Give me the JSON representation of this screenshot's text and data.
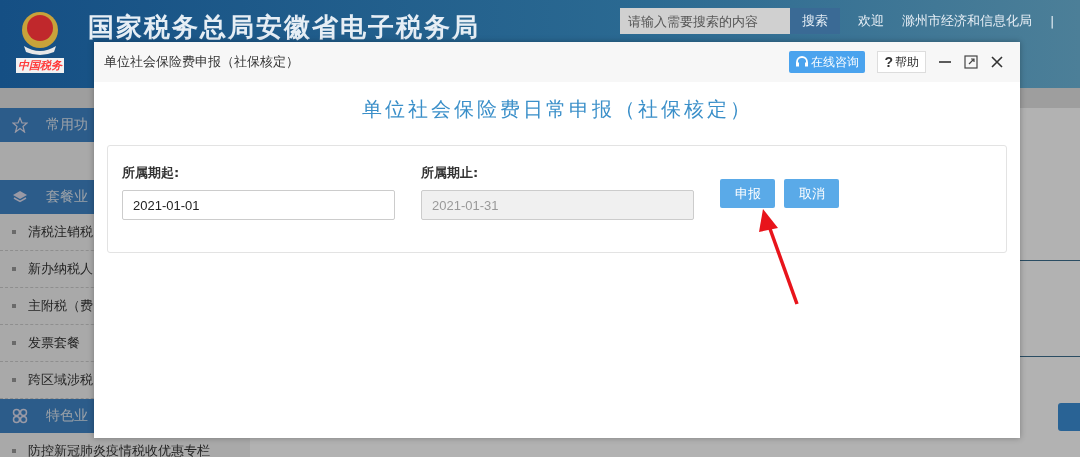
{
  "header": {
    "logo_text": "中国税务",
    "site_title": "国家税务总局安徽省电子税务局",
    "search": {
      "placeholder": "请输入需要搜索的内容"
    },
    "search_button": "搜索",
    "welcome": "欢迎",
    "user": "滁州市经济和信息化局",
    "separator": "|"
  },
  "sidebar": {
    "sections": [
      {
        "kind": "star",
        "title": "常用功"
      },
      {
        "kind": "layers",
        "title": "套餐业",
        "items": [
          "清税注销税",
          "新办纳税人",
          "主附税（费",
          "发票套餐",
          "跨区域涉税"
        ]
      },
      {
        "kind": "clover",
        "title": "特色业",
        "items": [
          "防控新冠肺炎疫情税收优惠专栏"
        ]
      }
    ]
  },
  "dialog": {
    "title": "单位社会保险费申报（社保核定）",
    "consult_button": "在线咨询",
    "help_icon": "?",
    "help_button": "帮助",
    "heading": "单位社会保险费日常申报（社保核定）",
    "fields": [
      {
        "label": "所属期起:",
        "value": "2021-01-01",
        "disabled": false
      },
      {
        "label": "所属期止:",
        "value": "2021-01-31",
        "disabled": true
      }
    ],
    "buttons": [
      "申报",
      "取消"
    ]
  }
}
